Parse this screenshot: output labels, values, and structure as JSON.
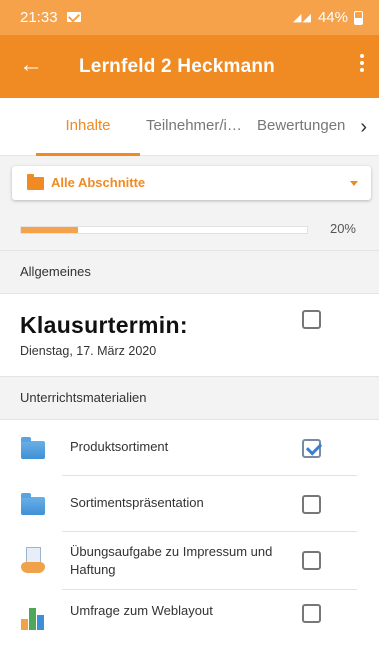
{
  "status_bar": {
    "time": "21:33",
    "signal": "◢◢",
    "battery": "44%"
  },
  "app_bar": {
    "title": "Lernfeld 2 Heckmann",
    "back_icon": "arrow-left-icon",
    "menu_icon": "more-vertical-icon"
  },
  "tabs": [
    {
      "label": "Inhalte",
      "active": true
    },
    {
      "label": "Teilnehmer/i…",
      "active": false
    },
    {
      "label": "Bewertungen",
      "active": false
    }
  ],
  "section_filter": {
    "selected": "Alle Abschnitte"
  },
  "progress": {
    "percent_label": "20%",
    "value": 0.2
  },
  "sections": [
    {
      "title": "Allgemeines",
      "items": [
        {
          "title": "Klausurtermin:",
          "subtitle": "Dienstag, 17. März 2020",
          "checked": false
        }
      ]
    },
    {
      "title": "Unterrichtsmaterialien",
      "items": [
        {
          "label": "Produktsortiment",
          "icon": "folder-icon",
          "checked": true
        },
        {
          "label": "Sortimentspräsentation",
          "icon": "folder-icon",
          "checked": false
        },
        {
          "label": "Übungsaufgabe zu Impressum und Haftung",
          "icon": "assignment-icon",
          "checked": false
        },
        {
          "label": "Umfrage zum Weblayout",
          "icon": "survey-chart-icon",
          "checked": false
        }
      ]
    }
  ],
  "colors": {
    "accent": "#f08a22",
    "status_bar": "#f6a24a",
    "checked": "#3b7fd4"
  }
}
